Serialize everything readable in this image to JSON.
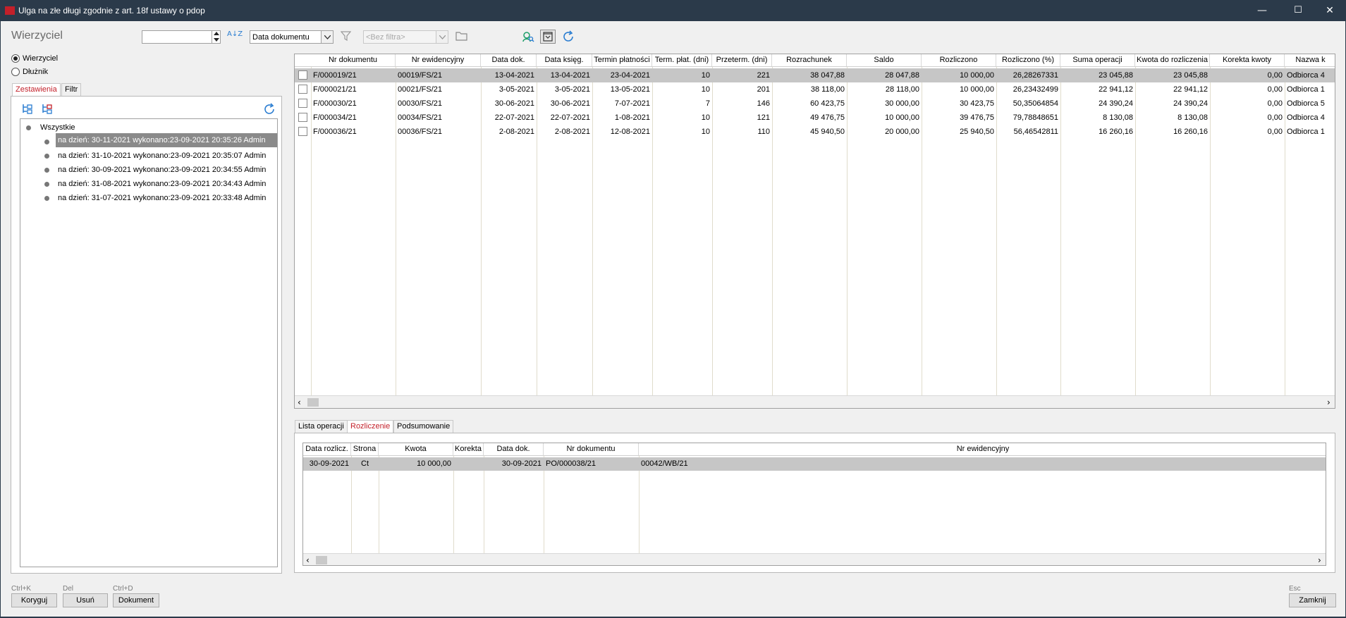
{
  "window": {
    "title": "Ulga na złe długi zgodnie z art. 18f ustawy o pdop",
    "minimize_icon": "—",
    "maximize_icon": "☐",
    "close_icon": "✕"
  },
  "header": {
    "section_title": "Wierzyciel",
    "number_input_value": "",
    "sort_icon": "A↓Z",
    "date_combo_value": "Data dokumentu",
    "filter_combo_placeholder": "<Bez filtra>"
  },
  "side": {
    "radio_creditor": "Wierzyciel",
    "radio_debtor": "Dłużnik",
    "tabs": [
      "Zestawienia",
      "Filtr"
    ],
    "tree_root": "Wszystkie",
    "tree_items": [
      "na dzień: 30-11-2021 wykonano:23-09-2021 20:35:26 Admin",
      "na dzień: 31-10-2021 wykonano:23-09-2021 20:35:07 Admin",
      "na dzień: 30-09-2021 wykonano:23-09-2021 20:34:55 Admin",
      "na dzień: 31-08-2021 wykonano:23-09-2021 20:34:43 Admin",
      "na dzień: 31-07-2021 wykonano:23-09-2021 20:33:48 Admin"
    ]
  },
  "main_grid": {
    "headers": [
      "Nr dokumentu",
      "Nr ewidencyjny",
      "Data dok.",
      "Data księg.",
      "Termin płatności",
      "Term. płat. (dni)",
      "Przeterm. (dni)",
      "Rozrachunek",
      "Saldo",
      "Rozliczono",
      "Rozliczono (%)",
      "Suma operacji",
      "Kwota do rozliczenia",
      "Korekta kwoty",
      "Nazwa k"
    ],
    "rows": [
      [
        "F/000019/21",
        "00019/FS/21",
        "13-04-2021",
        "13-04-2021",
        "23-04-2021",
        "10",
        "221",
        "38 047,88",
        "28 047,88",
        "10 000,00",
        "26,28267331",
        "23 045,88",
        "23 045,88",
        "0,00",
        "Odbiorca 4"
      ],
      [
        "F/000021/21",
        "00021/FS/21",
        "3-05-2021",
        "3-05-2021",
        "13-05-2021",
        "10",
        "201",
        "38 118,00",
        "28 118,00",
        "10 000,00",
        "26,23432499",
        "22 941,12",
        "22 941,12",
        "0,00",
        "Odbiorca 1"
      ],
      [
        "F/000030/21",
        "00030/FS/21",
        "30-06-2021",
        "30-06-2021",
        "7-07-2021",
        "7",
        "146",
        "60 423,75",
        "30 000,00",
        "30 423,75",
        "50,35064854",
        "24 390,24",
        "24 390,24",
        "0,00",
        "Odbiorca 5"
      ],
      [
        "F/000034/21",
        "00034/FS/21",
        "22-07-2021",
        "22-07-2021",
        "1-08-2021",
        "10",
        "121",
        "49 476,75",
        "10 000,00",
        "39 476,75",
        "79,78848651",
        "8 130,08",
        "8 130,08",
        "0,00",
        "Odbiorca 4"
      ],
      [
        "F/000036/21",
        "00036/FS/21",
        "2-08-2021",
        "2-08-2021",
        "12-08-2021",
        "10",
        "110",
        "45 940,50",
        "20 000,00",
        "25 940,50",
        "56,46542811",
        "16 260,16",
        "16 260,16",
        "0,00",
        "Odbiorca 1"
      ]
    ]
  },
  "bottom_tabs": [
    "Lista operacji",
    "Rozliczenie",
    "Podsumowanie"
  ],
  "sub_grid": {
    "headers": [
      "Data rozlicz.",
      "Strona",
      "Kwota",
      "Korekta",
      "Data dok.",
      "Nr dokumentu",
      "Nr ewidencyjny"
    ],
    "rows": [
      [
        "30-09-2021",
        "Ct",
        "10 000,00",
        "",
        "30-09-2021",
        "PO/000038/21",
        "00042/WB/21"
      ]
    ]
  },
  "footer": {
    "buttons": [
      {
        "hint": "Ctrl+K",
        "label": "Koryguj"
      },
      {
        "hint": "Del",
        "label": "Usuń"
      },
      {
        "hint": "Ctrl+D",
        "label": "Dokument"
      }
    ],
    "close": {
      "hint": "Esc",
      "label": "Zamknij"
    }
  },
  "colors": {
    "titlebar": "#2b3a4a",
    "accent": "#c3202a",
    "icon": "#2a7dd1",
    "selection": "#c6c6c6"
  }
}
